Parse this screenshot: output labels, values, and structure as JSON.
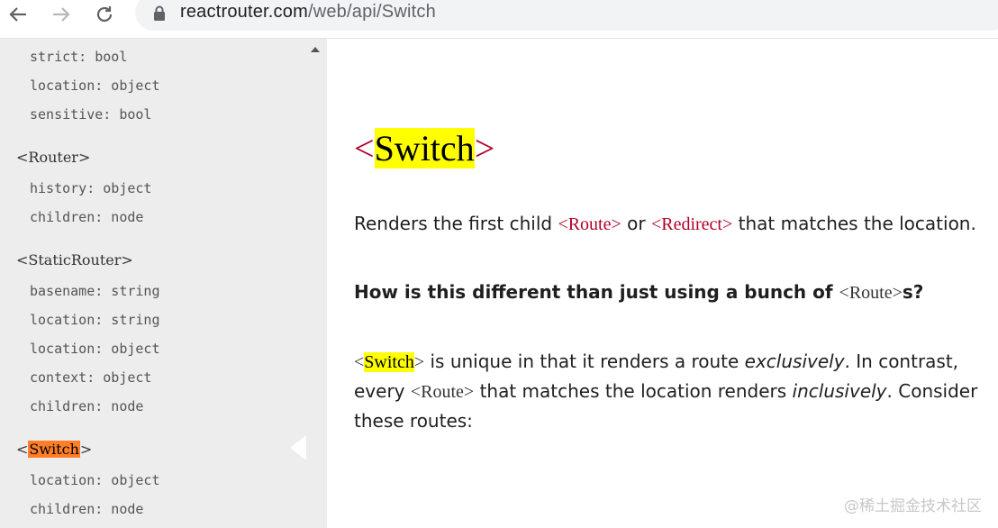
{
  "browser": {
    "url_host": "reactrouter.com",
    "url_path": "/web/api/Switch"
  },
  "sidebar": {
    "groups": [
      {
        "items": [
          "strict: bool",
          "location: object",
          "sensitive: bool"
        ]
      },
      {
        "title": "<Router>",
        "items": [
          "history: object",
          "children: node"
        ]
      },
      {
        "title": "<StaticRouter>",
        "items": [
          "basename: string",
          "location: string",
          "location: object",
          "context: object",
          "children: node"
        ]
      },
      {
        "title_prefix": "<",
        "title_hl": "Switch",
        "title_suffix": ">",
        "items": [
          "location: object",
          "children: node"
        ]
      }
    ]
  },
  "main": {
    "title_open": "<",
    "title_hl": "Switch",
    "title_close": ">",
    "p1": {
      "a": "Renders the first child ",
      "code1": "<Route>",
      "b": " or ",
      "code2": "<Redirect>",
      "c": " that matches the location."
    },
    "h": {
      "a": "How is this different than just using a bunch of ",
      "code": "<Route>",
      "b": "s?"
    },
    "p2": {
      "code_open": "<",
      "code_hl": "Switch",
      "code_close": ">",
      "a": " is unique in that it renders a route ",
      "em1": "exclusively",
      "b": ". In contrast,",
      "c": "every ",
      "code2": "<Route>",
      "d": " that matches the location renders ",
      "em2": "inclusively",
      "e": ". Consider",
      "f": "these routes:"
    }
  },
  "watermark": "@稀土掘金技术社区"
}
